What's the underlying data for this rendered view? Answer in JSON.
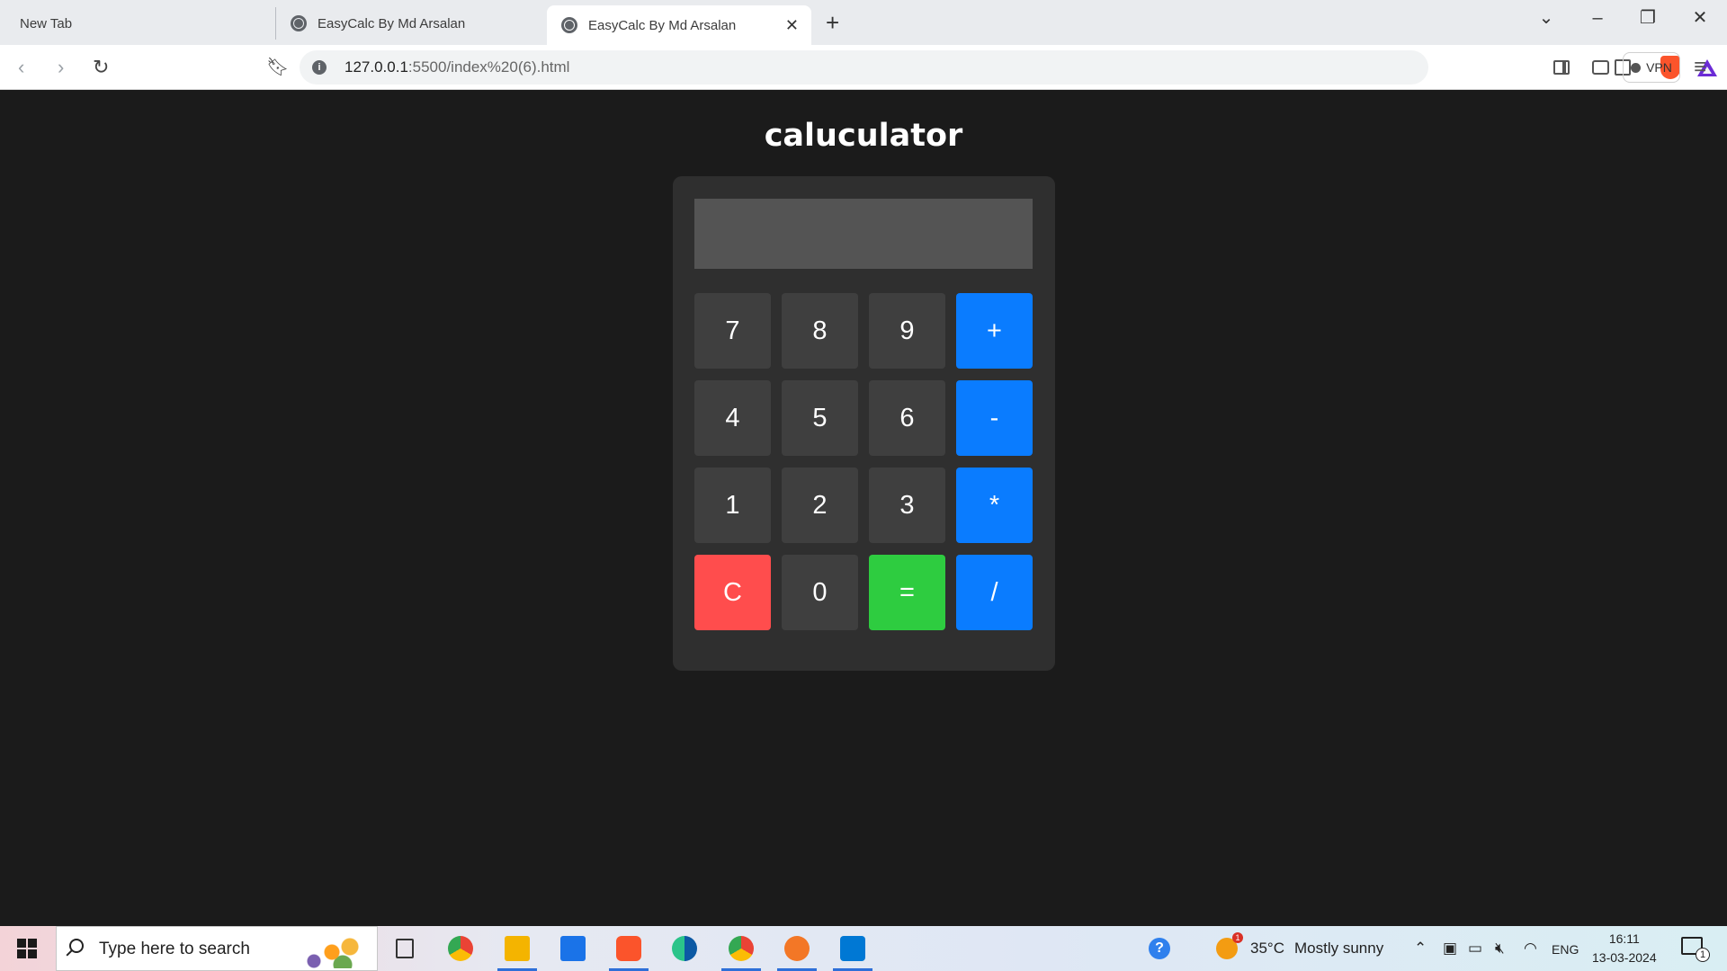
{
  "browser": {
    "tabs": [
      {
        "title": "New Tab"
      },
      {
        "title": "EasyCalc By Md Arsalan"
      },
      {
        "title": "EasyCalc By Md Arsalan",
        "active": true
      }
    ],
    "new_tab_symbol": "+",
    "address": {
      "host": "127.0.0.1",
      "rest": ":5500/index%20(6).html"
    },
    "vpn_label": "VPN",
    "icons": [
      "back-icon",
      "forward-icon",
      "reload-icon",
      "bookmark-icon",
      "site-info-icon",
      "share-icon",
      "brave-shields-icon",
      "brave-rewards-icon",
      "sidebar-icon",
      "wallet-icon",
      "menu-icon"
    ]
  },
  "page": {
    "title": "caluculator",
    "display_value": "",
    "keys": [
      {
        "label": "7",
        "kind": "digit"
      },
      {
        "label": "8",
        "kind": "digit"
      },
      {
        "label": "9",
        "kind": "digit"
      },
      {
        "label": "+",
        "kind": "operator"
      },
      {
        "label": "4",
        "kind": "digit"
      },
      {
        "label": "5",
        "kind": "digit"
      },
      {
        "label": "6",
        "kind": "digit"
      },
      {
        "label": "-",
        "kind": "operator"
      },
      {
        "label": "1",
        "kind": "digit"
      },
      {
        "label": "2",
        "kind": "digit"
      },
      {
        "label": "3",
        "kind": "digit"
      },
      {
        "label": "*",
        "kind": "operator"
      },
      {
        "label": "C",
        "kind": "clear"
      },
      {
        "label": "0",
        "kind": "digit"
      },
      {
        "label": "=",
        "kind": "equals"
      },
      {
        "label": "/",
        "kind": "operator"
      }
    ],
    "colors": {
      "background": "#1b1b1b",
      "calculator_body": "#2f2f2f",
      "display": "#545454",
      "digit_key": "#3f3f3f",
      "operator_key": "#0a7cff",
      "clear_key": "#ff4d4d",
      "equals_key": "#2ecc40"
    }
  },
  "taskbar": {
    "search_placeholder": "Type here to search",
    "weather_temp": "35°C",
    "weather_text": "Mostly sunny",
    "weather_badge": "1",
    "language": "ENG",
    "time": "16:11",
    "date": "13-03-2024",
    "notification_count": "1"
  }
}
